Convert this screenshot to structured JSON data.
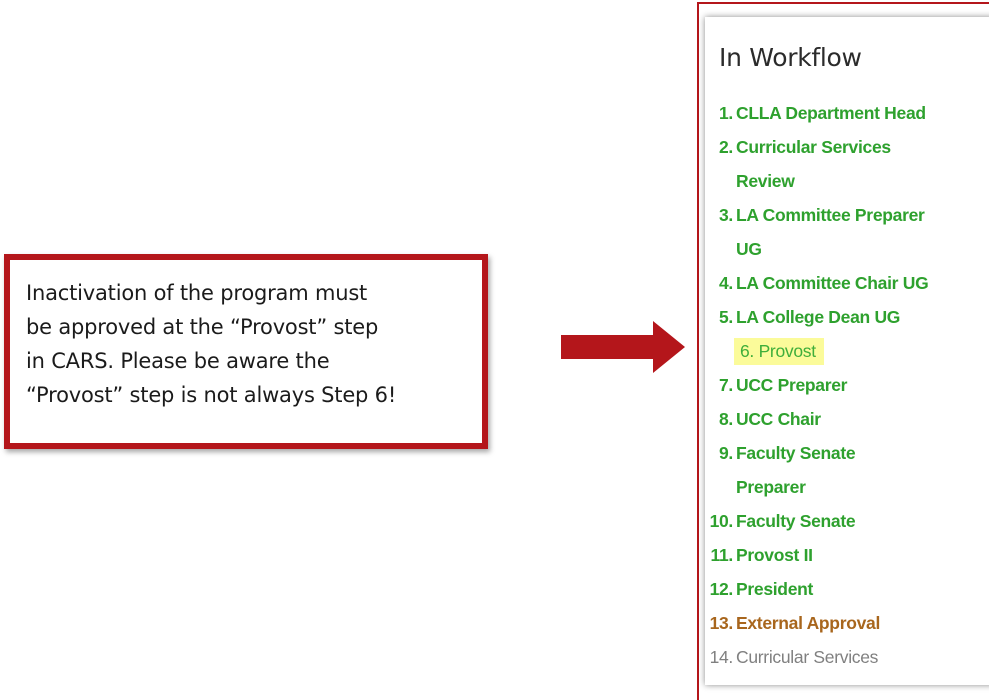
{
  "callout": {
    "text": "Inactivation of the program must\nbe approved at the “Provost” step\nin CARS. Please be aware the\n“Provost” step is not always Step 6!"
  },
  "workflow": {
    "title": "In Workflow",
    "steps": [
      {
        "num": "1.",
        "label": "CLLA Department Head",
        "status": "complete"
      },
      {
        "num": "2.",
        "label": "Curricular Services\nReview",
        "status": "complete"
      },
      {
        "num": "3.",
        "label": "LA Committee Preparer\nUG",
        "status": "complete"
      },
      {
        "num": "4.",
        "label": "LA Committee Chair UG",
        "status": "complete"
      },
      {
        "num": "5.",
        "label": "LA College Dean UG",
        "status": "complete"
      },
      {
        "num": "6.",
        "label": "Provost",
        "status": "current"
      },
      {
        "num": "7.",
        "label": "UCC Preparer",
        "status": "complete"
      },
      {
        "num": "8.",
        "label": "UCC Chair",
        "status": "complete"
      },
      {
        "num": "9.",
        "label": "Faculty Senate\nPreparer",
        "status": "complete"
      },
      {
        "num": "10.",
        "label": "Faculty Senate",
        "status": "complete"
      },
      {
        "num": "11.",
        "label": "Provost II",
        "status": "complete"
      },
      {
        "num": "12.",
        "label": "President",
        "status": "complete"
      },
      {
        "num": "13.",
        "label": "External Approval",
        "status": "external"
      },
      {
        "num": "14.",
        "label": "Curricular Services",
        "status": "pending"
      }
    ]
  },
  "colors": {
    "border_red": "#b4161b",
    "complete_green": "#2ea12e",
    "highlight_yellow": "#fbfb9a",
    "external_orange": "#a8661d",
    "pending_gray": "#808080"
  },
  "icons": {
    "arrow": "right-arrow-icon"
  }
}
